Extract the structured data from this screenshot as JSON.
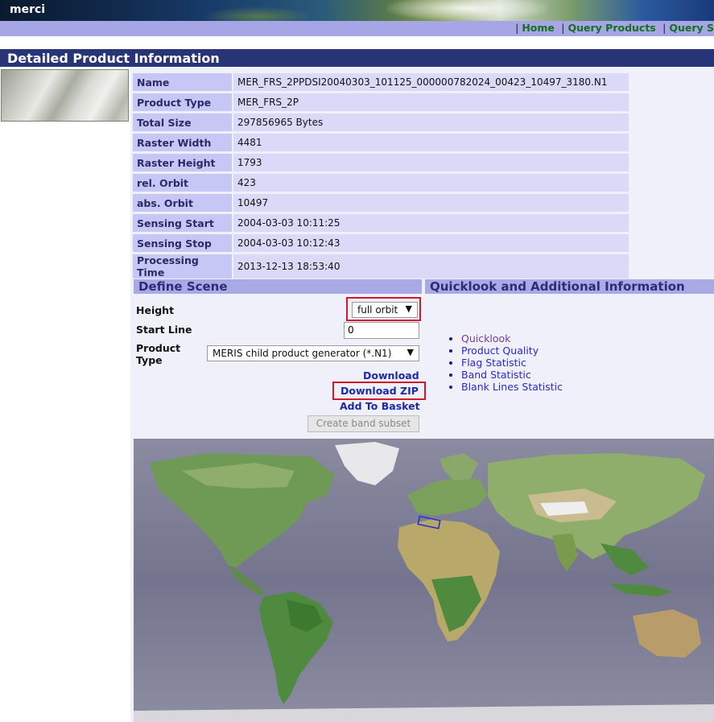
{
  "app": {
    "logo": "merci"
  },
  "nav": {
    "items": [
      {
        "label": "Home"
      },
      {
        "label": "Query Products"
      },
      {
        "label": "Query S"
      }
    ]
  },
  "page": {
    "title": "Detailed Product Information"
  },
  "product": {
    "rows": [
      {
        "key": "Name",
        "value": "MER_FRS_2PPDSI20040303_101125_000000782024_00423_10497_3180.N1"
      },
      {
        "key": "Product Type",
        "value": "MER_FRS_2P"
      },
      {
        "key": "Total Size",
        "value": "297856965 Bytes"
      },
      {
        "key": "Raster Width",
        "value": "4481"
      },
      {
        "key": "Raster Height",
        "value": "1793"
      },
      {
        "key": "rel. Orbit",
        "value": "423"
      },
      {
        "key": "abs. Orbit",
        "value": "10497"
      },
      {
        "key": "Sensing Start",
        "value": "2004-03-03 10:11:25"
      },
      {
        "key": "Sensing Stop",
        "value": "2004-03-03 10:12:43"
      },
      {
        "key": "Processing Time",
        "value": "2013-12-13 18:53:40"
      }
    ]
  },
  "define_scene": {
    "header": "Define Scene",
    "height_label": "Height",
    "height_value": "full orbit",
    "start_line_label": "Start Line",
    "start_line_value": "0",
    "product_type_label": "Product Type",
    "product_type_value": "MERIS child product generator (*.N1)",
    "download_label": "Download",
    "download_zip_label": "Download ZIP",
    "add_basket_label": "Add To Basket",
    "create_subset_label": "Create band subset"
  },
  "quicklook": {
    "header": "Quicklook and Additional Information",
    "links": [
      {
        "label": "Quicklook"
      },
      {
        "label": "Product Quality"
      },
      {
        "label": "Flag Statistic"
      },
      {
        "label": "Band Statistic"
      },
      {
        "label": "Blank Lines Statistic"
      }
    ]
  },
  "icons": {
    "dropdown": "chevron-down-icon"
  },
  "colors": {
    "title_bar": "#273478",
    "nav_bar": "#a6a6e6",
    "highlight": "#d11b2a",
    "footprint": "#2233cc"
  }
}
